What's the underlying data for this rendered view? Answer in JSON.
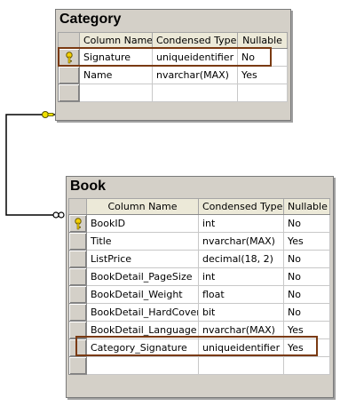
{
  "category": {
    "title": "Category",
    "columns": [
      "Column Name",
      "Condensed Type",
      "Nullable"
    ],
    "rows": [
      {
        "name": "Signature",
        "type": "uniqueidentifier",
        "nullable": "No",
        "key": true
      },
      {
        "name": "Name",
        "type": "nvarchar(MAX)",
        "nullable": "Yes",
        "key": false
      }
    ]
  },
  "book": {
    "title": "Book",
    "columns": [
      "Column Name",
      "Condensed Type",
      "Nullable"
    ],
    "rows": [
      {
        "name": "BookID",
        "type": "int",
        "nullable": "No",
        "key": true
      },
      {
        "name": "Title",
        "type": "nvarchar(MAX)",
        "nullable": "Yes",
        "key": false
      },
      {
        "name": "ListPrice",
        "type": "decimal(18, 2)",
        "nullable": "No",
        "key": false
      },
      {
        "name": "BookDetail_PageSize",
        "type": "int",
        "nullable": "No",
        "key": false
      },
      {
        "name": "BookDetail_Weight",
        "type": "float",
        "nullable": "No",
        "key": false
      },
      {
        "name": "BookDetail_HardCover",
        "type": "bit",
        "nullable": "No",
        "key": false
      },
      {
        "name": "BookDetail_Language",
        "type": "nvarchar(MAX)",
        "nullable": "Yes",
        "key": false
      },
      {
        "name": "Category_Signature",
        "type": "uniqueidentifier",
        "nullable": "Yes",
        "key": false
      }
    ]
  },
  "colors": {
    "highlight": "#7a3a12",
    "connector": "#000000",
    "key": "#e8c400"
  }
}
